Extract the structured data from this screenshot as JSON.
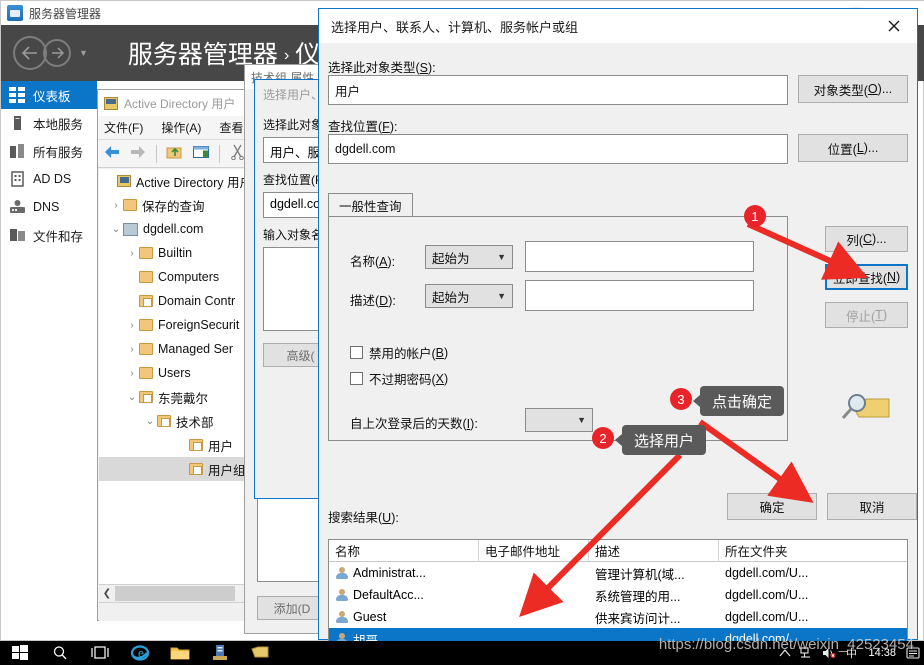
{
  "server_manager": {
    "title": "服务器管理器",
    "title_icon": "server-manager-icon",
    "breadcrumb_root": "服务器管理器",
    "breadcrumb_sep": "›",
    "breadcrumb_current": "仪",
    "window_buttons": {
      "minimize": "—",
      "maximize": "▢",
      "close": "✕"
    },
    "nav": {
      "back_icon": "back-arrow-icon",
      "forward_icon": "forward-arrow-icon",
      "caret_icon": "chevron-down-icon"
    },
    "sidebar": {
      "items": [
        {
          "label": "仪表板",
          "icon": "dashboard-icon",
          "active": true
        },
        {
          "label": "本地服务",
          "icon": "local-server-icon",
          "active": false
        },
        {
          "label": "所有服务",
          "icon": "all-servers-icon",
          "active": false
        },
        {
          "label": "AD DS",
          "icon": "ad-ds-icon",
          "active": false
        },
        {
          "label": "DNS",
          "icon": "dns-icon",
          "active": false
        },
        {
          "label": "文件和存",
          "icon": "file-storage-icon",
          "active": false
        }
      ]
    }
  },
  "ad_window": {
    "title": "Active Directory 用户",
    "title_icon": "console-icon",
    "menu": [
      "文件(F)",
      "操作(A)",
      "查看"
    ],
    "toolbar_icons": [
      "back-arrow-icon",
      "forward-arrow-icon",
      "up-folder-icon",
      "show-pane-icon",
      "cut-icon",
      "copy-icon"
    ],
    "tree": [
      {
        "indent": 0,
        "chev": "",
        "icon": "console-root-icon",
        "label": "Active Directory 用户"
      },
      {
        "indent": 0,
        "chev": "›",
        "icon": "folder-icon",
        "label": "保存的查询"
      },
      {
        "indent": 0,
        "chev": "⌄",
        "icon": "domain-icon",
        "label": "dgdell.com"
      },
      {
        "indent": 1,
        "chev": "›",
        "icon": "folder-icon",
        "label": "Builtin"
      },
      {
        "indent": 1,
        "chev": "",
        "icon": "folder-icon",
        "label": "Computers"
      },
      {
        "indent": 1,
        "chev": "",
        "icon": "ou-folder-icon",
        "label": "Domain Contr"
      },
      {
        "indent": 1,
        "chev": "›",
        "icon": "folder-icon",
        "label": "ForeignSecurit"
      },
      {
        "indent": 1,
        "chev": "›",
        "icon": "folder-icon",
        "label": "Managed Ser"
      },
      {
        "indent": 1,
        "chev": "›",
        "icon": "folder-icon",
        "label": "Users"
      },
      {
        "indent": 1,
        "chev": "⌄",
        "icon": "ou-folder-icon",
        "label": "东莞戴尔"
      },
      {
        "indent": 2,
        "chev": "⌄",
        "icon": "ou-folder-icon",
        "label": "技术部"
      },
      {
        "indent": 3,
        "chev": "",
        "icon": "ou-folder-icon",
        "label": "用户"
      },
      {
        "indent": 3,
        "chev": "",
        "icon": "ou-folder-icon",
        "label": "用户组",
        "selected": true
      }
    ],
    "hscroll_left_icon": "scroll-left-icon"
  },
  "group_properties_dialog": {
    "title": "技术组 属性",
    "add_button": "添加(D"
  },
  "select_user_small_dialog": {
    "title": "选择用户、",
    "object_type_label": "选择此对象",
    "object_type_value": "用户、服务",
    "location_label": "查找位置(F",
    "location_value": "dgdell.co",
    "names_label": "输入对象名",
    "advanced_button": "高级("
  },
  "main_dialog": {
    "title": "选择用户、联系人、计算机、服务帐户或组",
    "close_icon": "close-icon",
    "object_type": {
      "label": "选择此对象类型(S):",
      "label_plain": "选择此对象类型(",
      "accel": "S",
      "value": "用户",
      "button": "对象类型(O)...",
      "button_plain": "对象类型(",
      "button_accel": "O",
      "button_tail": ")..."
    },
    "location": {
      "label": "查找位置(F):",
      "label_plain": "查找位置(",
      "accel": "F",
      "value": "dgdell.com",
      "button": "位置(L)...",
      "button_plain": "位置(",
      "button_accel": "L",
      "button_tail": ")..."
    },
    "tab": {
      "label": "一般性查询"
    },
    "query": {
      "name_label_plain": "名称(",
      "name_accel": "A",
      "name_label_tail": "):",
      "name_condition": "起始为",
      "name_value": "",
      "desc_label_plain": "描述(",
      "desc_accel": "D",
      "desc_label_tail": "):",
      "desc_condition": "起始为",
      "desc_value": "",
      "disabled_accounts_plain": "禁用的帐户(",
      "disabled_accounts_accel": "B",
      "disabled_accounts_tail": ")",
      "disabled_accounts_checked": false,
      "nonexpiring_plain": "不过期密码(",
      "nonexpiring_accel": "X",
      "nonexpiring_tail": ")",
      "nonexpiring_checked": false,
      "days_since_logon_plain": "自上次登录后的天数(",
      "days_since_logon_accel": "I",
      "days_since_logon_tail": "):",
      "days_since_logon_value": ""
    },
    "side_buttons": {
      "columns_plain": "列(",
      "columns_accel": "C",
      "columns_tail": ")...",
      "find_now_plain": "立即查找(",
      "find_now_accel": "N",
      "find_now_tail": ")",
      "stop_plain": "停止(",
      "stop_accel": "T",
      "stop_tail": ")",
      "stop_disabled": true,
      "magnifier_icon": "magnifier-folder-icon"
    },
    "footer": {
      "ok": "确定",
      "cancel": "取消"
    },
    "results": {
      "label_plain": "搜索结果(",
      "label_accel": "U",
      "label_tail": "):",
      "columns": [
        "名称",
        "电子邮件地址",
        "描述",
        "所在文件夹"
      ],
      "rows": [
        {
          "icon": "user-icon",
          "name": "Administrat...",
          "email": "",
          "desc": "管理计算机(域...",
          "folder": "dgdell.com/U...",
          "selected": false
        },
        {
          "icon": "user-disabled-icon",
          "name": "DefaultAcc...",
          "email": "",
          "desc": "系统管理的用...",
          "folder": "dgdell.com/U...",
          "selected": false
        },
        {
          "icon": "user-disabled-icon",
          "name": "Guest",
          "email": "",
          "desc": "供来宾访问计...",
          "folder": "dgdell.com/U...",
          "selected": false
        },
        {
          "icon": "user-icon",
          "name": "胡哥",
          "email": "",
          "desc": "",
          "folder": "dgdell.com/...",
          "selected": true
        }
      ]
    }
  },
  "annotations": [
    {
      "badge": "1",
      "text": null
    },
    {
      "badge": "2",
      "text": "选择用户"
    },
    {
      "badge": "3",
      "text": "点击确定"
    }
  ],
  "annotation_color": "#e8242a",
  "taskbar": {
    "icons": [
      "start-icon",
      "search-icon",
      "task-view-icon",
      "internet-explorer-icon",
      "file-explorer-icon",
      "server-manager-icon",
      "folder-yellow-icon"
    ],
    "tray_icons": [
      "show-hidden-icons-icon",
      "network-icon",
      "volume-icon",
      "ime-icon",
      "action-center-icon"
    ],
    "clock_time": "14:38"
  },
  "watermark": "https://blog.csdn.net/weixin_42523454"
}
